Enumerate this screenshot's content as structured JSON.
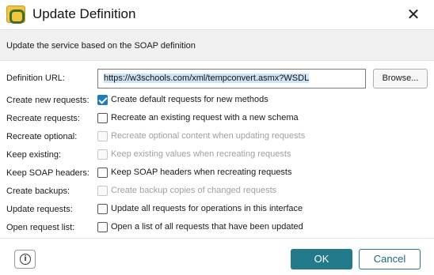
{
  "window": {
    "title": "Update Definition",
    "close_glyph": "✕"
  },
  "banner": {
    "text": "Update the service based on the SOAP definition"
  },
  "definition": {
    "label": "Definition URL:",
    "url": "https://w3schools.com/xml/tempconvert.asmx?WSDL",
    "browse_label": "Browse..."
  },
  "options": [
    {
      "label": "Create new requests:",
      "text": "Create default requests for new methods",
      "checked": true,
      "enabled": true
    },
    {
      "label": "Recreate requests:",
      "text": "Recreate an existing request with a new schema",
      "checked": false,
      "enabled": true
    },
    {
      "label": "Recreate optional:",
      "text": "Recreate optional content when updating requests",
      "checked": false,
      "enabled": false
    },
    {
      "label": "Keep existing:",
      "text": "Keep existing values when recreating requests",
      "checked": false,
      "enabled": false
    },
    {
      "label": "Keep SOAP headers:",
      "text": "Keep SOAP headers when recreating requests",
      "checked": false,
      "enabled": true
    },
    {
      "label": "Create backups:",
      "text": "Create backup copies of changed requests",
      "checked": false,
      "enabled": false
    },
    {
      "label": "Update requests:",
      "text": "Update all requests for operations in this interface",
      "checked": false,
      "enabled": true
    },
    {
      "label": "Open request list:",
      "text": "Open a list of all requests that have been updated",
      "checked": false,
      "enabled": true
    }
  ],
  "footer": {
    "info_glyph": "i",
    "ok_label": "OK",
    "cancel_label": "Cancel"
  },
  "colors": {
    "accent": "#227a8b",
    "checkbox_checked": "#1f7db8",
    "banner_bg": "#f0f0f0"
  },
  "icons": {
    "app": "soapui-logo-icon",
    "close": "close-icon",
    "info": "info-icon"
  }
}
